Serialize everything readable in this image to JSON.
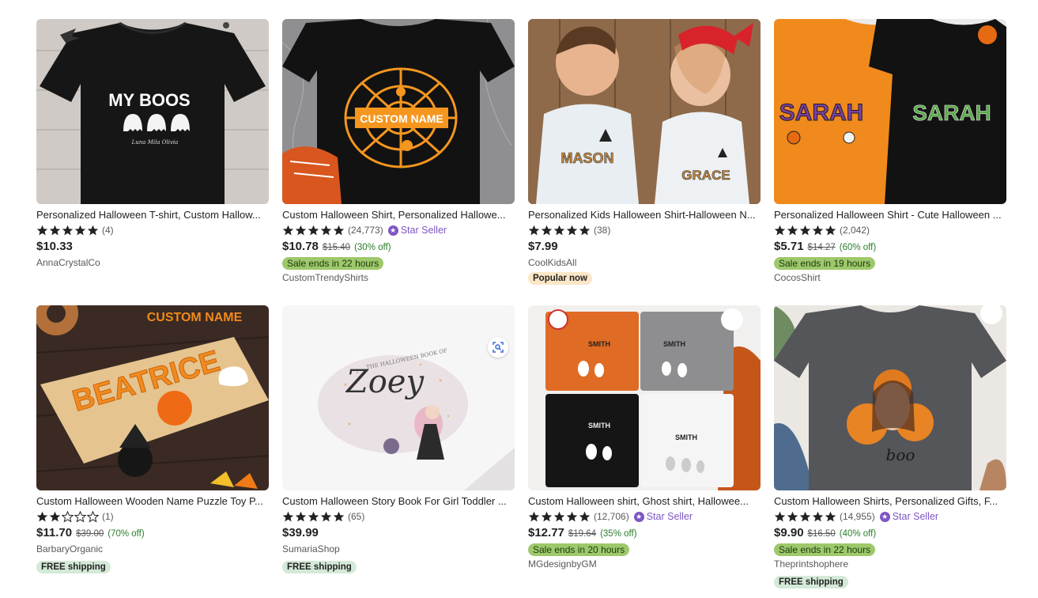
{
  "colors": {
    "star": "#222222",
    "star_seller": "#7e56c4",
    "sale_badge": "#9ec86b",
    "popular_badge": "#fbe6c6",
    "shipping_badge": "#d4e9d7",
    "discount": "#2a7d2c"
  },
  "listings": [
    {
      "title": "Personalized Halloween T-shirt, Custom Hallow...",
      "rating": 5,
      "reviews": "(4)",
      "price": "$10.33",
      "shop": "AnnaCrystalCo",
      "image_text": "MY BOOS",
      "image_names": "Luna   Mila   Olivia"
    },
    {
      "title": "Custom Halloween Shirt, Personalized Hallowe...",
      "rating": 5,
      "reviews": "(24,773)",
      "star_seller": "Star Seller",
      "price": "$10.78",
      "original_price": "$15.40",
      "discount": "(30% off)",
      "sale": "Sale ends in 22 hours",
      "shop": "CustomTrendyShirts",
      "image_text": "CUSTOM NAME"
    },
    {
      "title": "Personalized Kids Halloween Shirt-Halloween N...",
      "rating": 5,
      "reviews": "(38)",
      "price": "$7.99",
      "shop": "CoolKidsAll",
      "popular": "Popular now",
      "image_text_1": "MASON",
      "image_text_2": "GRACE"
    },
    {
      "title": "Personalized Halloween Shirt - Cute Halloween ...",
      "rating": 5,
      "reviews": "(2,042)",
      "price": "$5.71",
      "original_price": "$14.27",
      "discount": "(60% off)",
      "sale": "Sale ends in 19 hours",
      "shop": "CocosShirt",
      "image_text": "SARAH"
    },
    {
      "title": "Custom Halloween Wooden Name Puzzle Toy P...",
      "rating": 2,
      "reviews": "(1)",
      "price": "$11.70",
      "original_price": "$39.00",
      "discount": "(70% off)",
      "shop": "BarbaryOrganic",
      "shipping": "FREE shipping",
      "image_text": "BEATRICE",
      "image_label": "CUSTOM NAME"
    },
    {
      "title": "Custom Halloween Story Book For Girl Toddler ...",
      "rating": 5,
      "reviews": "(65)",
      "price": "$39.99",
      "shop": "SumariaShop",
      "shipping": "FREE shipping",
      "image_text_1": "THE HALLOWEEN BOOK OF",
      "image_text_2": "Zoey"
    },
    {
      "title": "Custom Halloween shirt, Ghost shirt, Hallowee...",
      "rating": 5,
      "reviews": "(12,706)",
      "star_seller": "Star Seller",
      "price": "$12.77",
      "original_price": "$19.64",
      "discount": "(35% off)",
      "sale": "Sale ends in 20 hours",
      "shop": "MGdesignbyGM",
      "image_text": "SMITH"
    },
    {
      "title": "Custom Halloween Shirts, Personalized Gifts, F...",
      "rating": 5,
      "reviews": "(14,955)",
      "star_seller": "Star Seller",
      "price": "$9.90",
      "original_price": "$16.50",
      "discount": "(40% off)",
      "sale": "Sale ends in 22 hours",
      "shop": "Theprintshophere",
      "shipping": "FREE shipping",
      "image_text": "boo"
    }
  ]
}
